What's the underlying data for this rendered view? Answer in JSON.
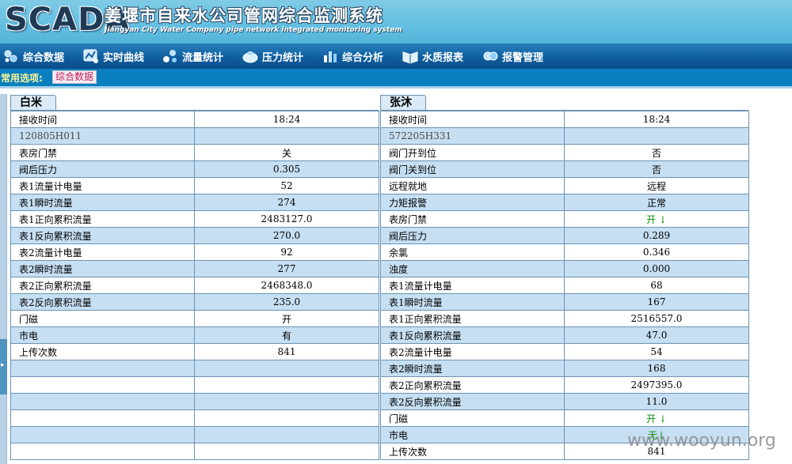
{
  "header": {
    "logo": "SCADA",
    "title": "姜堰市自来水公司管网综合监测系统",
    "subtitle": "Jiangyan City Water Company pipe network integrated monitoring system"
  },
  "nav": {
    "items": [
      {
        "label": "综合数据",
        "icon": "dashboard-icon"
      },
      {
        "label": "实时曲线",
        "icon": "curve-icon"
      },
      {
        "label": "流量统计",
        "icon": "flow-icon"
      },
      {
        "label": "压力统计",
        "icon": "pressure-icon"
      },
      {
        "label": "综合分析",
        "icon": "bar-chart-icon"
      },
      {
        "label": "水质报表",
        "icon": "report-book-icon"
      },
      {
        "label": "报警管理",
        "icon": "alarm-icon"
      }
    ]
  },
  "options": {
    "label": "常用选项:",
    "button": "综合数据"
  },
  "panels": {
    "left": {
      "title": "白米",
      "rows": [
        {
          "k": "接收时间",
          "v": "18:24"
        },
        {
          "k": "120805H011",
          "v": ""
        },
        {
          "k": "表房门禁",
          "v": "关"
        },
        {
          "k": "阀后压力",
          "v": "0.305"
        },
        {
          "k": "表1流量计电量",
          "v": "52"
        },
        {
          "k": "表1瞬时流量",
          "v": "274"
        },
        {
          "k": "表1正向累积流量",
          "v": "2483127.0"
        },
        {
          "k": "表1反向累积流量",
          "v": "270.0"
        },
        {
          "k": "表2流量计电量",
          "v": "92"
        },
        {
          "k": "表2瞬时流量",
          "v": "277"
        },
        {
          "k": "表2正向累积流量",
          "v": "2468348.0"
        },
        {
          "k": "表2反向累积流量",
          "v": "235.0"
        },
        {
          "k": "门磁",
          "v": "开"
        },
        {
          "k": "市电",
          "v": "有"
        },
        {
          "k": "上传次数",
          "v": "841"
        },
        {
          "k": "",
          "v": ""
        },
        {
          "k": "",
          "v": ""
        },
        {
          "k": "",
          "v": ""
        },
        {
          "k": "",
          "v": ""
        },
        {
          "k": "",
          "v": ""
        },
        {
          "k": "",
          "v": ""
        }
      ]
    },
    "right": {
      "title": "张沐",
      "rows": [
        {
          "k": "接收时间",
          "v": "18:24"
        },
        {
          "k": "572205H331",
          "v": ""
        },
        {
          "k": "阀门开到位",
          "v": "否"
        },
        {
          "k": "阀门关到位",
          "v": "否"
        },
        {
          "k": "远程就地",
          "v": "远程"
        },
        {
          "k": "力矩报警",
          "v": "正常"
        },
        {
          "k": "表房门禁",
          "v": "开 ↓"
        },
        {
          "k": "阀后压力",
          "v": "0.289"
        },
        {
          "k": "余氯",
          "v": "0.346"
        },
        {
          "k": "浊度",
          "v": "0.000"
        },
        {
          "k": "表1流量计电量",
          "v": "68"
        },
        {
          "k": "表1瞬时流量",
          "v": "167"
        },
        {
          "k": "表1正向累积流量",
          "v": "2516557.0"
        },
        {
          "k": "表1反向累积流量",
          "v": "47.0"
        },
        {
          "k": "表2流量计电量",
          "v": "54"
        },
        {
          "k": "表2瞬时流量",
          "v": "168"
        },
        {
          "k": "表2正向累积流量",
          "v": "2497395.0"
        },
        {
          "k": "表2反向累积流量",
          "v": "11.0"
        },
        {
          "k": "门磁",
          "v": "开 ↓"
        },
        {
          "k": "市电",
          "v": "无↓"
        },
        {
          "k": "上传次数",
          "v": "841"
        }
      ]
    }
  },
  "watermark": "www.wooyun.org",
  "colors": {
    "header_bg": "#63bfe2",
    "nav_bg": "#0f5e9f",
    "option_bar_bg": "#0a7fc0",
    "row_stripe": "#c6dff3",
    "grid_border": "#6b93b3",
    "status_green": "#0a8a0a"
  }
}
